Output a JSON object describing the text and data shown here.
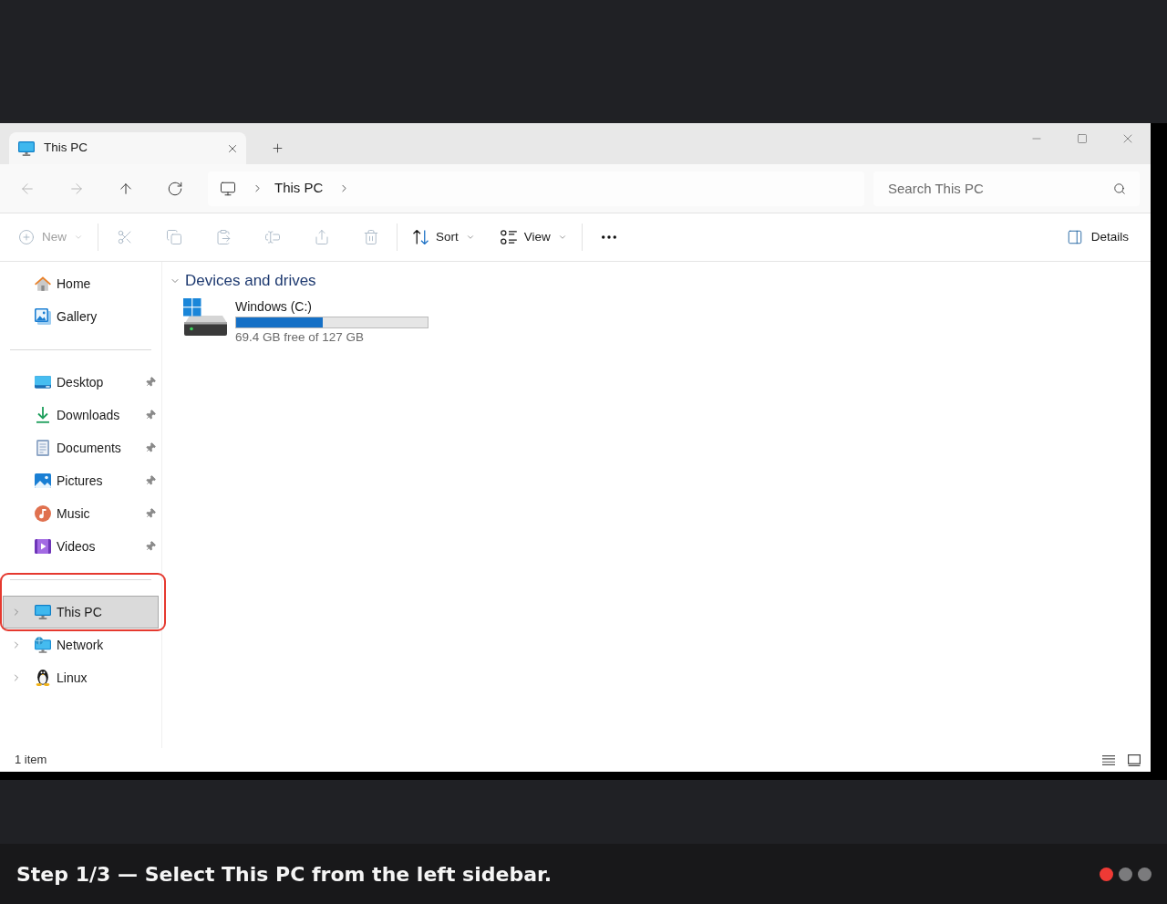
{
  "tabs": [
    {
      "title": "This PC",
      "selected": true
    }
  ],
  "nav_buttons": [
    {
      "disabled": true
    },
    {
      "disabled": true
    },
    {
      "disabled": false
    },
    {
      "disabled": false
    }
  ],
  "address_bar": {
    "breadcrumbs": [
      "This PC"
    ]
  },
  "search": {
    "placeholder": "Search This PC"
  },
  "toolbar": {
    "groups": [
      [
        {
          "kind": "dropdown",
          "label": "New",
          "disabled": true
        }
      ],
      [
        {
          "kind": "icon",
          "disabled": true
        },
        {
          "kind": "icon",
          "disabled": true
        },
        {
          "kind": "icon",
          "disabled": true
        },
        {
          "kind": "icon",
          "disabled": true
        },
        {
          "kind": "icon",
          "disabled": true
        },
        {
          "kind": "icon",
          "disabled": true
        }
      ],
      [
        {
          "kind": "dropdown",
          "label": "Sort",
          "disabled": false
        },
        {
          "kind": "dropdown",
          "label": "View",
          "disabled": false
        }
      ],
      [
        {
          "kind": "more",
          "disabled": false
        }
      ]
    ],
    "details_button": {
      "label": "Details"
    }
  },
  "sidebar": {
    "sections": [
      {
        "items": [
          {
            "label": "Home",
            "pinned": false,
            "selected": false,
            "highlighted": false
          },
          {
            "label": "Gallery",
            "pinned": false,
            "selected": false,
            "highlighted": false
          }
        ]
      },
      {
        "items": [
          {
            "label": "Desktop",
            "pinned": true,
            "selected": false,
            "highlighted": false
          },
          {
            "label": "Downloads",
            "pinned": true,
            "selected": false,
            "highlighted": false
          },
          {
            "label": "Documents",
            "pinned": true,
            "selected": false,
            "highlighted": false
          },
          {
            "label": "Pictures",
            "pinned": true,
            "selected": false,
            "highlighted": false
          },
          {
            "label": "Music",
            "pinned": true,
            "selected": false,
            "highlighted": false
          },
          {
            "label": "Videos",
            "pinned": true,
            "selected": false,
            "highlighted": false
          }
        ]
      },
      {
        "items": [
          {
            "label": "This PC",
            "pinned": false,
            "expanded": false,
            "selected": true,
            "highlighted": true
          },
          {
            "label": "Network",
            "pinned": false,
            "expanded": false,
            "selected": false,
            "highlighted": false
          },
          {
            "label": "Linux",
            "pinned": false,
            "expanded": false,
            "selected": false,
            "highlighted": false
          }
        ]
      }
    ]
  },
  "content": {
    "groups": [
      {
        "title": "Devices and drives",
        "expanded": true,
        "items": [
          {
            "name": "Windows (C:)",
            "level": 0.45,
            "space": "69.4 GB free of 127 GB"
          }
        ]
      }
    ]
  },
  "status_bar": {
    "item_count": "1 item"
  },
  "caption": {
    "text": "Step 1/3 — Select This PC from the left sidebar.",
    "steps": [
      {
        "selected": true
      },
      {
        "selected": false
      },
      {
        "selected": false
      }
    ]
  }
}
